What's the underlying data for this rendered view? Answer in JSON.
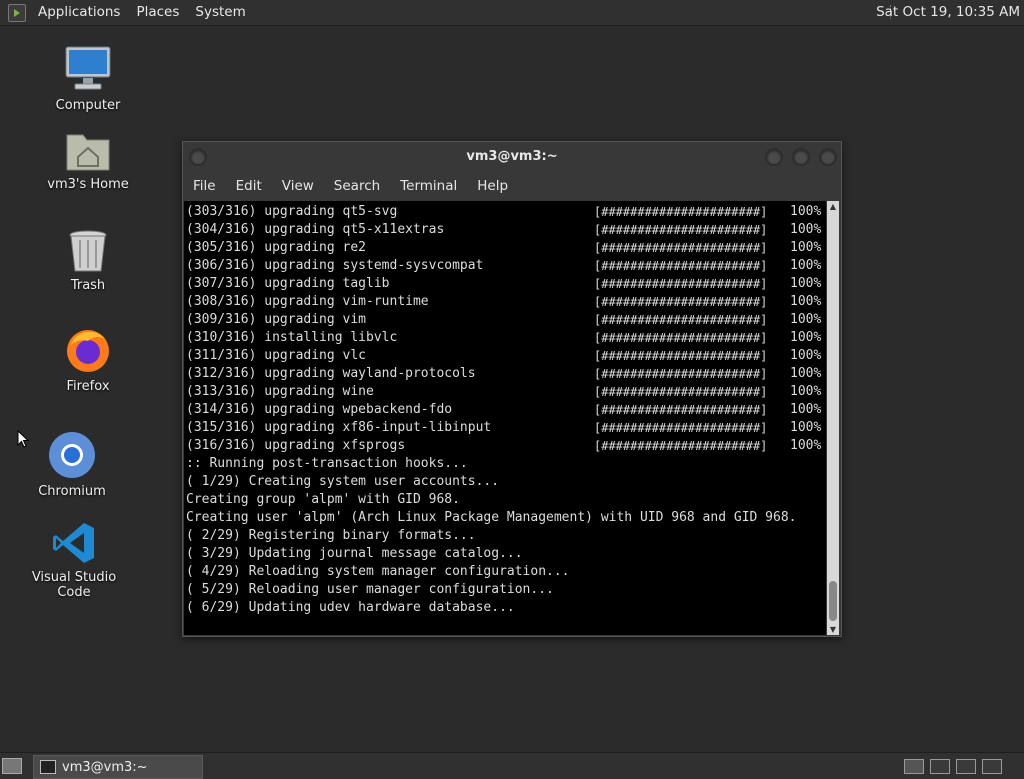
{
  "top_panel": {
    "menus": [
      "Applications",
      "Places",
      "System"
    ],
    "clock": "Sat Oct 19, 10:35 AM"
  },
  "desktop_icons": [
    {
      "label": "Computer",
      "icon": "computer-icon"
    },
    {
      "label": "vm3's Home",
      "icon": "home-folder-icon"
    },
    {
      "label": "Trash",
      "icon": "trash-icon"
    },
    {
      "label": "Firefox",
      "icon": "firefox-icon"
    },
    {
      "label": "Chromium",
      "icon": "chromium-icon"
    },
    {
      "label": "Visual Studio Code",
      "icon": "vscode-icon"
    }
  ],
  "terminal": {
    "title": "vm3@vm3:~",
    "menu": [
      "File",
      "Edit",
      "View",
      "Search",
      "Terminal",
      "Help"
    ],
    "progress_lines": [
      {
        "text": "(303/316) upgrading qt5-svg",
        "bar": "[######################]",
        "pct": "100%"
      },
      {
        "text": "(304/316) upgrading qt5-x11extras",
        "bar": "[######################]",
        "pct": "100%"
      },
      {
        "text": "(305/316) upgrading re2",
        "bar": "[######################]",
        "pct": "100%"
      },
      {
        "text": "(306/316) upgrading systemd-sysvcompat",
        "bar": "[######################]",
        "pct": "100%"
      },
      {
        "text": "(307/316) upgrading taglib",
        "bar": "[######################]",
        "pct": "100%"
      },
      {
        "text": "(308/316) upgrading vim-runtime",
        "bar": "[######################]",
        "pct": "100%"
      },
      {
        "text": "(309/316) upgrading vim",
        "bar": "[######################]",
        "pct": "100%"
      },
      {
        "text": "(310/316) installing libvlc",
        "bar": "[######################]",
        "pct": "100%"
      },
      {
        "text": "(311/316) upgrading vlc",
        "bar": "[######################]",
        "pct": "100%"
      },
      {
        "text": "(312/316) upgrading wayland-protocols",
        "bar": "[######################]",
        "pct": "100%"
      },
      {
        "text": "(313/316) upgrading wine",
        "bar": "[######################]",
        "pct": "100%"
      },
      {
        "text": "(314/316) upgrading wpebackend-fdo",
        "bar": "[######################]",
        "pct": "100%"
      },
      {
        "text": "(315/316) upgrading xf86-input-libinput",
        "bar": "[######################]",
        "pct": "100%"
      },
      {
        "text": "(316/316) upgrading xfsprogs",
        "bar": "[######################]",
        "pct": "100%"
      }
    ],
    "output_lines": [
      ":: Running post-transaction hooks...",
      "( 1/29) Creating system user accounts...",
      "Creating group 'alpm' with GID 968.",
      "Creating user 'alpm' (Arch Linux Package Management) with UID 968 and GID 968.",
      "( 2/29) Registering binary formats...",
      "( 3/29) Updating journal message catalog...",
      "( 4/29) Reloading system manager configuration...",
      "( 5/29) Reloading user manager configuration...",
      "( 6/29) Updating udev hardware database..."
    ]
  },
  "bottom_panel": {
    "task_label": "vm3@vm3:~"
  }
}
